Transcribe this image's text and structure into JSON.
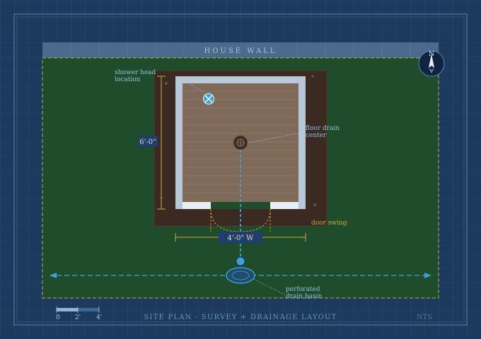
{
  "wall": {
    "label": "HOUSE WALL"
  },
  "annotations": {
    "shower_head": [
      "shower head",
      "location"
    ],
    "floor_drain": [
      "floor drain",
      "center"
    ],
    "door_swing": "door swing",
    "basin": [
      "perforated",
      "drain basin"
    ]
  },
  "dimensions": {
    "depth": "6'-0\"",
    "width": "4'-0\" W"
  },
  "compass": {
    "label": "N"
  },
  "scale_bar": {
    "ticks": [
      "0",
      "2'",
      "4'"
    ]
  },
  "footer": {
    "title": "SITE PLAN - SURVEY + DRAINAGE LAYOUT",
    "scale_note": "NTS"
  },
  "colors": {
    "background": "#1b3a5e",
    "grid": "#2f5680",
    "lawn": "#1f4d2b",
    "gravel_pad": "#3a2a22",
    "tile_floor": "#7f6a5a",
    "curb": "#b8c8d8",
    "dimension": "#c9a83a",
    "drain_line": "#3ea0d8",
    "annotation_text": "#8fc1e0"
  }
}
